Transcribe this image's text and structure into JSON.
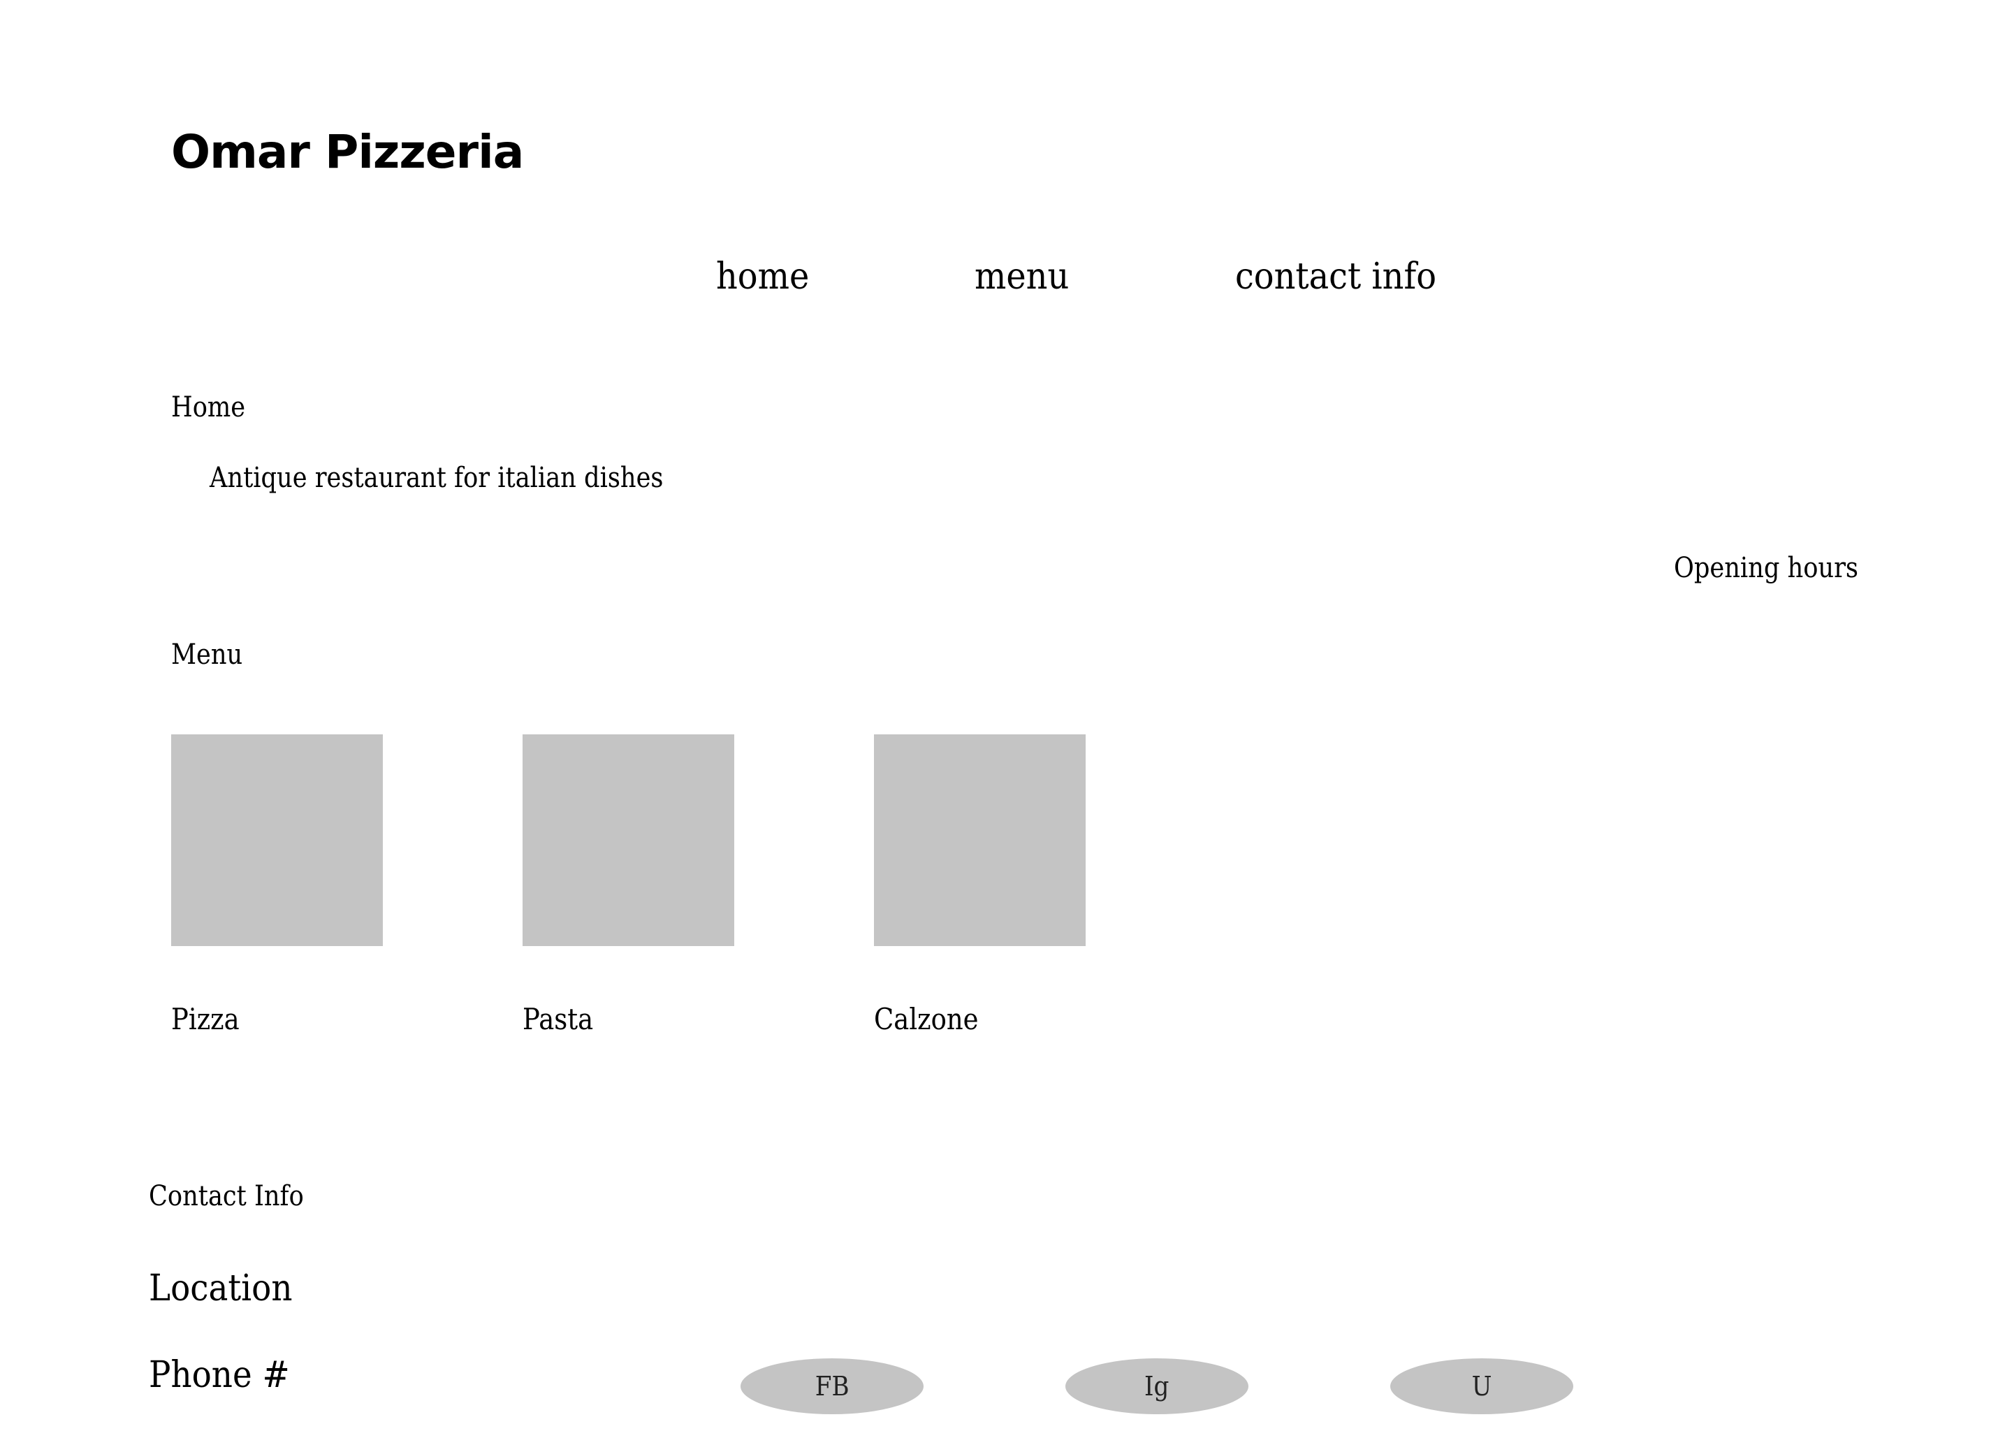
{
  "brand": {
    "name": "Omar Pizzeria"
  },
  "nav": {
    "home": "home",
    "menu": "menu",
    "contact": "contact info"
  },
  "home_section": {
    "title": "Home",
    "tagline": "Antique restaurant for italian dishes",
    "opening_hours": "Opening hours"
  },
  "menu_section": {
    "title": "Menu",
    "items": [
      {
        "label": "Pizza"
      },
      {
        "label": "Pasta"
      },
      {
        "label": "Calzone"
      }
    ]
  },
  "contact_section": {
    "title": "Contact Info",
    "location": "Location",
    "phone": "Phone #"
  },
  "social": [
    {
      "label": "FB"
    },
    {
      "label": "Ig"
    },
    {
      "label": "U"
    }
  ],
  "colors": {
    "background": "#ffffff",
    "text": "#000000",
    "placeholder": "#c4c4c4"
  }
}
